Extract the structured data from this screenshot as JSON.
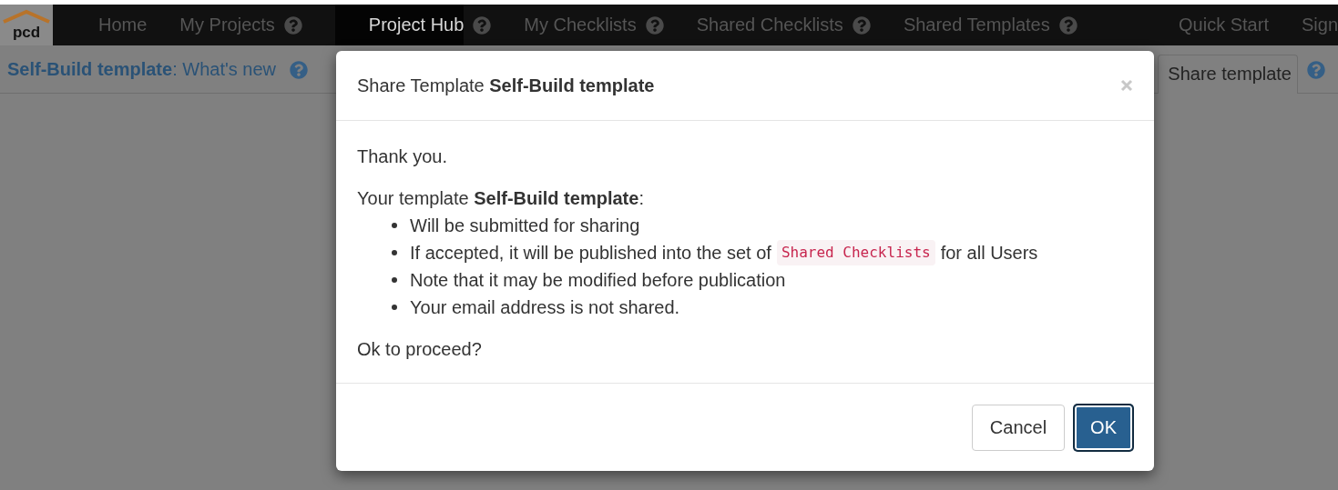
{
  "logo": {
    "text": "pcd"
  },
  "nav": [
    {
      "label": "Home",
      "selected": false,
      "help": false
    },
    {
      "label": "My Projects",
      "selected": false,
      "help": true
    },
    {
      "label": "Project Hub",
      "selected": true,
      "help": true
    },
    {
      "label": "My Checklists",
      "selected": false,
      "help": true
    },
    {
      "label": "Shared Checklists",
      "selected": false,
      "help": true
    },
    {
      "label": "Shared Templates",
      "selected": false,
      "help": true
    }
  ],
  "nav_right": [
    {
      "label": "Quick Start"
    },
    {
      "label": "Sign"
    }
  ],
  "subheader": {
    "title": "**Self-Build template**: What's new",
    "tab": "Share template"
  },
  "modal": {
    "title": "Share Template **Self-Build template**",
    "intro": "Thank you.",
    "lead": "Your template **Self-Build template**:",
    "bullets": [
      {
        "parts": [
          {
            "kind": "text",
            "text": "Will be submitted for sharing"
          }
        ]
      },
      {
        "parts": [
          {
            "kind": "text",
            "text": "If accepted, it will be published into the set of"
          },
          {
            "kind": "code",
            "text": "Shared Checklists"
          },
          {
            "kind": "text",
            "text": "for all Users"
          }
        ]
      },
      {
        "parts": [
          {
            "kind": "text",
            "text": "Note that it may be modified before publication"
          }
        ]
      },
      {
        "parts": [
          {
            "kind": "text",
            "text": "Your email address is not shared."
          }
        ]
      }
    ],
    "question": "Ok to proceed?",
    "buttons": [
      {
        "label": "Cancel",
        "kind": "default"
      },
      {
        "label": "OK",
        "kind": "primary"
      }
    ]
  }
}
